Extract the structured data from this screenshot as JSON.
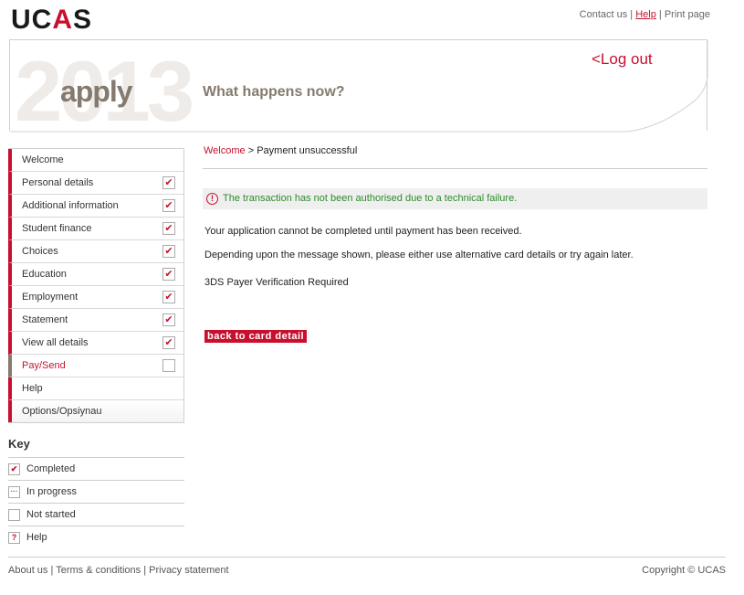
{
  "brand": {
    "logo_pre": "UC",
    "logo_a": "A",
    "logo_post": "S"
  },
  "top_links": {
    "contact": "Contact us",
    "sep1": " | ",
    "help": "Help",
    "sep2": " | ",
    "print": "Print page"
  },
  "banner": {
    "year": "2013",
    "apply": "apply",
    "heading": "What happens now?",
    "logout": "<Log out"
  },
  "breadcrumb": {
    "home": "Welcome",
    "sep": " > ",
    "current": "Payment unsuccessful"
  },
  "alert": {
    "icon": "!",
    "message": "The transaction has not been authorised due to a technical failure."
  },
  "main": {
    "para1": "Your application cannot be completed until payment has been received.",
    "para2": "Depending upon the message shown, please either use alternative card details or try again later.",
    "para3": "3DS Payer Verification Required",
    "back_button": "back to card detail"
  },
  "nav": {
    "items": [
      {
        "label": "Welcome",
        "status": "none"
      },
      {
        "label": "Personal details",
        "status": "completed"
      },
      {
        "label": "Additional information",
        "status": "completed"
      },
      {
        "label": "Student finance",
        "status": "completed"
      },
      {
        "label": "Choices",
        "status": "completed"
      },
      {
        "label": "Education",
        "status": "completed"
      },
      {
        "label": "Employment",
        "status": "completed"
      },
      {
        "label": "Statement",
        "status": "completed"
      },
      {
        "label": "View all details",
        "status": "completed"
      },
      {
        "label": "Pay/Send",
        "status": "not-started"
      },
      {
        "label": "Help",
        "status": "none"
      },
      {
        "label": "Options/Opsiynau",
        "status": "none"
      }
    ]
  },
  "key": {
    "title": "Key",
    "items": [
      {
        "label": "Completed",
        "glyph": "✔"
      },
      {
        "label": "In progress",
        "glyph": "···"
      },
      {
        "label": "Not started",
        "glyph": ""
      },
      {
        "label": "Help",
        "glyph": "?"
      }
    ]
  },
  "footer": {
    "about": "About us",
    "sep1": " | ",
    "terms": "Terms & conditions",
    "sep2": " | ",
    "privacy": "Privacy statement",
    "copyright": "Copyright © UCAS"
  },
  "colors": {
    "accent": "#c8102e",
    "muted": "#857a6e",
    "success_text": "#2e8b2e"
  }
}
